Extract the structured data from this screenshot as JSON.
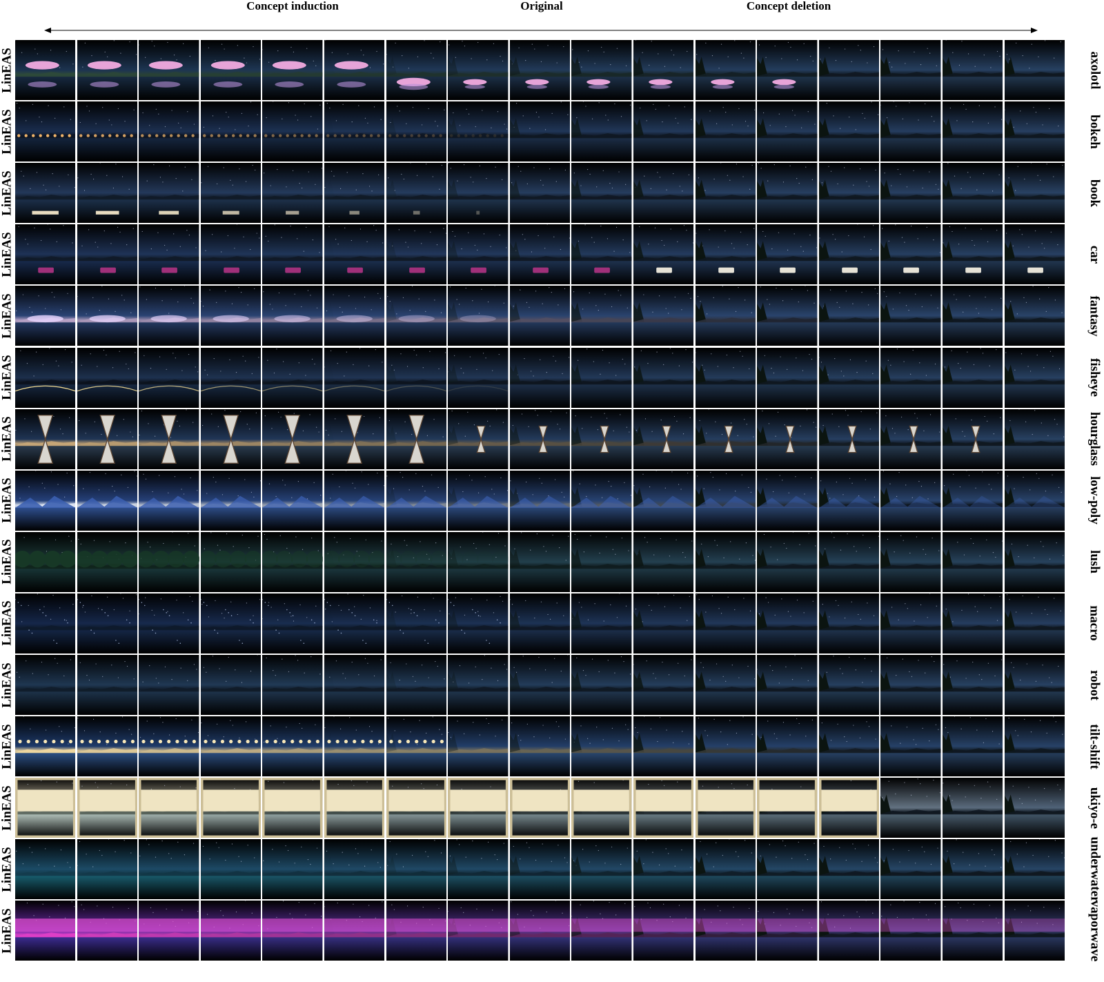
{
  "headers": {
    "left": "Concept induction",
    "middle": "Original",
    "right": "Concept deletion"
  },
  "method_label": "LinEAS",
  "columns_per_row": 17,
  "rows": [
    {
      "concept": "axolotl",
      "sky": "#1c3350",
      "horizon": "#2e4a3a",
      "water": "#16283e",
      "object": "axolotl"
    },
    {
      "concept": "bokeh",
      "sky": "#1a2d4e",
      "horizon": "#0e1626",
      "water": "#13233b",
      "object": "bokeh"
    },
    {
      "concept": "book",
      "sky": "#23385a",
      "horizon": "#111b29",
      "water": "#1b2e48",
      "object": "book"
    },
    {
      "concept": "car",
      "sky": "#1e3256",
      "horizon": "#101a28",
      "water": "#17294a",
      "object": "car"
    },
    {
      "concept": "fantasy",
      "sky": "#2a4374",
      "horizon": "#b9a3c7",
      "water": "#23375f",
      "object": "glow"
    },
    {
      "concept": "fisheye",
      "sky": "#1c2f4c",
      "horizon": "#0c121c",
      "water": "#16263e",
      "object": "fisheye"
    },
    {
      "concept": "hourglass",
      "sky": "#1f3454",
      "horizon": "#c9a878",
      "water": "#2a3a4c",
      "object": "hourglass"
    },
    {
      "concept": "low-poly",
      "sky": "#25407a",
      "horizon": "#dfe6f2",
      "water": "#2d4d8c",
      "object": "mountains"
    },
    {
      "concept": "lush",
      "sky": "#1d3c3a",
      "horizon": "#10251c",
      "water": "#173334",
      "object": "trees"
    },
    {
      "concept": "macro",
      "sky": "#15274a",
      "horizon": "#0e1a2c",
      "water": "#132442",
      "object": "dots"
    },
    {
      "concept": "robot",
      "sky": "#1f3752",
      "horizon": "#101c2a",
      "water": "#1c3148",
      "object": "none"
    },
    {
      "concept": "tilt-shift",
      "sky": "#1e3a6a",
      "horizon": "#f2d9a0",
      "water": "#2b4d80",
      "object": "lights"
    },
    {
      "concept": "ukiyo-e",
      "sky": "#e9dfc0",
      "horizon": "#5e6a60",
      "water": "#aab9b2",
      "object": "ukiyo"
    },
    {
      "concept": "underwater",
      "sky": "#1b4b66",
      "horizon": "#133b4c",
      "water": "#175a6a",
      "object": "none"
    },
    {
      "concept": "vaporwave",
      "sky": "#6a2aa8",
      "horizon": "#e040c8",
      "water": "#3a2a8c",
      "object": "vapor"
    }
  ]
}
